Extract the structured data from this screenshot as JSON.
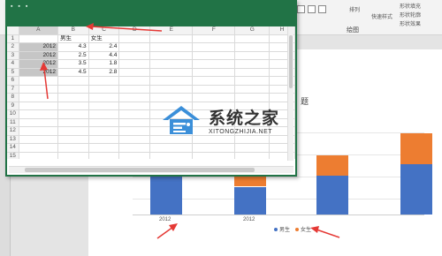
{
  "ribbon": {
    "label_arrange": "排列",
    "label_quick_style": "快速样式",
    "label_drawing": "绘图",
    "label_shape_fill": "形状填充",
    "label_shape_outline": "形状轮廓",
    "label_shape_effect": "形状效果"
  },
  "chart": {
    "title_fragment": "题",
    "x_ticks": [
      "2012",
      "2012"
    ],
    "legend": [
      {
        "name": "男生",
        "color": "#4472c4"
      },
      {
        "name": "女生",
        "color": "#ed7d31"
      }
    ]
  },
  "chart_data": {
    "type": "bar",
    "categories": [
      "2012",
      "2012",
      "2012",
      "2012"
    ],
    "series": [
      {
        "name": "男生",
        "values": [
          4.3,
          2.5,
          3.5,
          4.5
        ]
      },
      {
        "name": "女生",
        "values": [
          2.4,
          4.4,
          1.8,
          2.8
        ]
      }
    ]
  },
  "excel": {
    "columns": [
      "A",
      "B",
      "C",
      "D",
      "E",
      "F",
      "G",
      "H"
    ],
    "header_row": {
      "row": "1",
      "A": "",
      "B": "男生",
      "C": "女生"
    },
    "rows": [
      {
        "row": "2",
        "A": "2012",
        "B": "4.3",
        "C": "2.4"
      },
      {
        "row": "3",
        "A": "2012",
        "B": "2.5",
        "C": "4.4"
      },
      {
        "row": "4",
        "A": "2012",
        "B": "3.5",
        "C": "1.8"
      },
      {
        "row": "5",
        "A": "2012",
        "B": "4.5",
        "C": "2.8"
      }
    ],
    "empty_rows": [
      "6",
      "7",
      "8",
      "9",
      "10",
      "11",
      "12",
      "13",
      "14",
      "15",
      "16",
      "17"
    ]
  },
  "watermark": {
    "main": "系统之家",
    "sub": "XITONGZHIJIA.NET"
  },
  "colors": {
    "excel_green": "#217346",
    "arrow_red": "#e53935",
    "bar_blue": "#4472c4",
    "bar_orange": "#ed7d31"
  }
}
